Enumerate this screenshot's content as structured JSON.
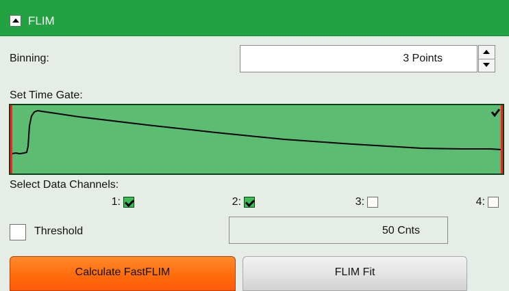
{
  "panel": {
    "title": "FLIM"
  },
  "binning": {
    "label": "Binning:",
    "value": "3 Points"
  },
  "time_gate": {
    "label": "Set Time Gate:",
    "colors": {
      "background": "#5bbc72",
      "trace": "#000000",
      "marker": "#ff2020"
    },
    "checked": true
  },
  "channels": {
    "label": "Select Data Channels:",
    "items": [
      {
        "label": "1:",
        "checked": true
      },
      {
        "label": "2:",
        "checked": true
      },
      {
        "label": "3:",
        "checked": false
      },
      {
        "label": "4:",
        "checked": false
      }
    ]
  },
  "threshold": {
    "label": "Threshold",
    "checked": false,
    "value": "50 Cnts"
  },
  "buttons": {
    "calculate": "Calculate FastFLIM",
    "fit": "FLIM Fit"
  },
  "colors": {
    "header": "#22a240",
    "accent_orange": "#ff6a0a",
    "panel_bg": "#e6ede7"
  }
}
